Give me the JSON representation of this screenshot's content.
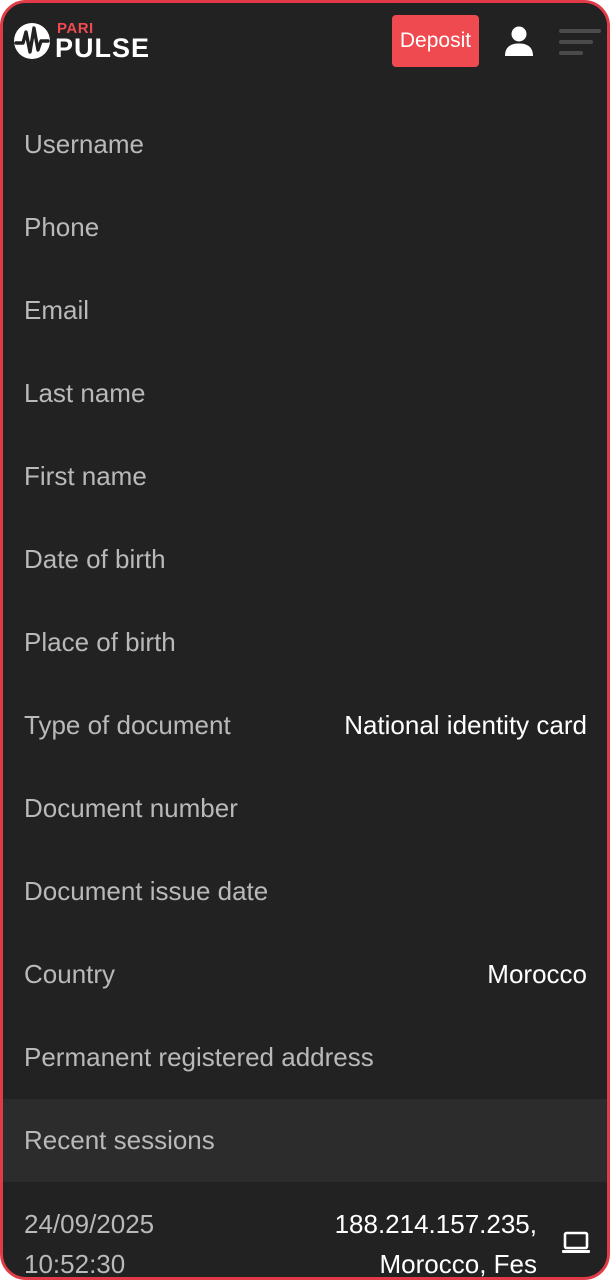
{
  "header": {
    "logo_top": "PARI",
    "logo_bottom": "PULSE",
    "deposit_label": "Deposit",
    "user_icon": "user-icon",
    "menu_icon": "hamburger-menu-icon"
  },
  "colors": {
    "accent": "#f04a51",
    "frame_border": "#e23b48",
    "background": "#222222",
    "section_header_bg": "#2c2c2c",
    "label_text": "#b9b9b9",
    "value_text": "#ffffff"
  },
  "profile": {
    "rows": [
      {
        "label": "Username",
        "value": ""
      },
      {
        "label": "Phone",
        "value": ""
      },
      {
        "label": "Email",
        "value": ""
      },
      {
        "label": "Last name",
        "value": ""
      },
      {
        "label": "First name",
        "value": ""
      },
      {
        "label": "Date of birth",
        "value": ""
      },
      {
        "label": "Place of birth",
        "value": ""
      },
      {
        "label": "Type of document",
        "value": "National identity card"
      },
      {
        "label": "Document number",
        "value": ""
      },
      {
        "label": "Document issue date",
        "value": ""
      },
      {
        "label": "Country",
        "value": "Morocco"
      },
      {
        "label": "Permanent registered address",
        "value": ""
      }
    ]
  },
  "sessions": {
    "title": "Recent sessions",
    "items": [
      {
        "date": "24/09/2025",
        "time": "10:52:30",
        "ip": "188.214.157.235,",
        "location": "Morocco, Fes",
        "device_icon": "laptop-icon"
      }
    ]
  }
}
